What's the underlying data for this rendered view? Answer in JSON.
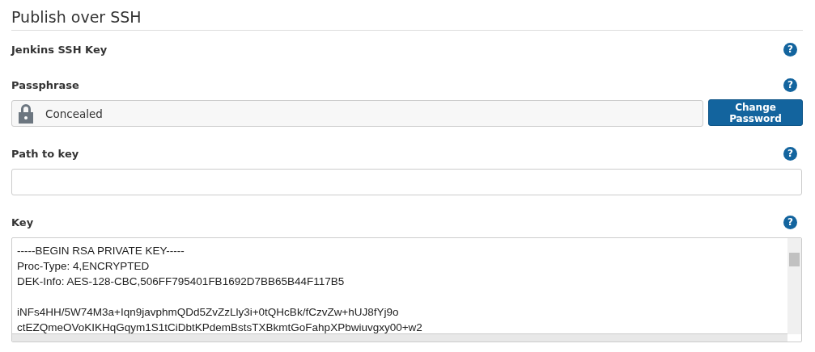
{
  "section": {
    "title": "Publish over SSH"
  },
  "fields": [
    {
      "kind": "heading",
      "label": "Jenkins SSH Key",
      "help": "?"
    },
    {
      "kind": "password",
      "label": "Passphrase",
      "help": "?",
      "value": "Concealed",
      "button": "Change Password"
    },
    {
      "kind": "text",
      "label": "Path to key",
      "help": "?"
    },
    {
      "kind": "textarea",
      "label": "Key",
      "help": "?",
      "value": "-----BEGIN RSA PRIVATE KEY-----\nProc-Type: 4,ENCRYPTED\nDEK-Info: AES-128-CBC,506FF795401FB1692D7BB65B44F117B5\n\niNFs4HH/5W74M3a+Iqn9javphmQDd5ZvZzLly3i+0tQHcBk/fCzvZw+hUJ8fYj9o\nctEZQmeOVoKIKHqGqym1S1tCiDbtKPdemBstsTXBkmtGoFahpXPbwiuvgxy00+w2"
    }
  ]
}
